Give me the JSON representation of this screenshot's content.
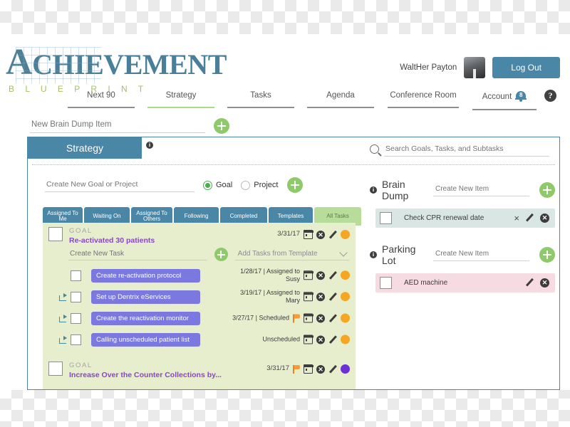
{
  "brand": {
    "name_main": "CHIEVEMENT",
    "name_first": "A",
    "subtitle": "B L U E P R I N T",
    "logo_color": "#4a7f99",
    "sub_color": "#a8bf63"
  },
  "header": {
    "user_name": "WaltHer Payton",
    "logout_label": "Log Out",
    "avatar_icon": "user-photo",
    "logout_color": "#4a86a5"
  },
  "nav": {
    "items": [
      {
        "label": "Next 90",
        "active": false
      },
      {
        "label": "Strategy",
        "active": true
      },
      {
        "label": "Tasks",
        "active": false
      },
      {
        "label": "Agenda",
        "active": false
      },
      {
        "label": "Conference Room",
        "active": false
      },
      {
        "label": "Account",
        "active": false
      }
    ],
    "notification_count": "8",
    "bell_icon": "bell-icon",
    "help_icon": "question-mark-icon",
    "help_label": "?",
    "active_underline_color": "#a9dc84",
    "underline_color": "#8d8d8d"
  },
  "brain_dump_top": {
    "placeholder": "New Brain Dump Item",
    "value": "",
    "add_icon": "plus-icon"
  },
  "panel": {
    "tab_label": "Strategy",
    "tab_color": "#4a86a5",
    "info_icon": "info-icon",
    "info_glyph": "i",
    "search": {
      "placeholder": "Search Goals, Tasks, and Subtasks",
      "value": "",
      "icon": "search-icon"
    }
  },
  "left": {
    "new_goal": {
      "placeholder": "Create New Goal or Project",
      "value": "",
      "add_icon": "plus-icon"
    },
    "radios": [
      {
        "label": "Goal",
        "selected": true
      },
      {
        "label": "Project",
        "selected": false
      }
    ],
    "filter_tabs": [
      {
        "label": "Assigned To Me",
        "active": false
      },
      {
        "label": "Waiting On",
        "active": false
      },
      {
        "label": "Assigned To Others",
        "active": false
      },
      {
        "label": "Following",
        "active": false
      },
      {
        "label": "Completed",
        "active": false
      },
      {
        "label": "Templates",
        "active": false
      },
      {
        "label": "All Tasks",
        "active": true
      }
    ],
    "goals": [
      {
        "kind_label": "GOAL",
        "title": "Re-activated 30 patients",
        "date": "3/31/17",
        "flag": false,
        "status_color": "#f5a623",
        "new_task_placeholder": "Create New Task",
        "new_task_value": "",
        "template_select_label": "Add Tasks from Template",
        "tasks": [
          {
            "title": "Create re-activation protocol",
            "meta": "1/28/17 | Assigned to Susy",
            "reopen": false,
            "flag": false,
            "status_color": "#f5a623"
          },
          {
            "title": "Set up Dentrix eServices",
            "meta": "3/19/17 | Assigned to Mary",
            "reopen": true,
            "flag": false,
            "status_color": "#f5a623"
          },
          {
            "title": "Create the reactivation monitor",
            "meta": "3/27/17 | Scheduled",
            "reopen": true,
            "flag": true,
            "status_color": "#f5a623"
          },
          {
            "title": "Calling unscheduled patient list",
            "meta": "Unscheduled",
            "reopen": true,
            "flag": false,
            "status_color": "#f5a623"
          }
        ]
      },
      {
        "kind_label": "GOAL",
        "title": "Increase Over the Counter Collections by...",
        "date": "3/31/17",
        "flag": true,
        "status_color": "#6c30d6",
        "tasks": []
      }
    ]
  },
  "right": {
    "sections": [
      {
        "title": "Brain Dump",
        "info_icon": "info-icon",
        "placeholder": "Create New Item",
        "value": "",
        "add_icon": "plus-icon",
        "items": [
          {
            "label": "Check CPR renewal date",
            "has_close": true,
            "style": "bd"
          }
        ]
      },
      {
        "title": "Parking Lot",
        "info_icon": "info-icon",
        "placeholder": "Create New Item",
        "value": "",
        "add_icon": "plus-icon",
        "items": [
          {
            "label": "AED machine",
            "has_close": false,
            "style": "pl"
          }
        ]
      }
    ],
    "close_glyph": "×"
  },
  "icons": {
    "calendar": "calendar-icon",
    "delete": "delete-circle-icon",
    "edit": "pencil-icon",
    "status": "status-dot-icon",
    "flag": "flag-icon",
    "reopen": "reopen-arrow-icon"
  }
}
